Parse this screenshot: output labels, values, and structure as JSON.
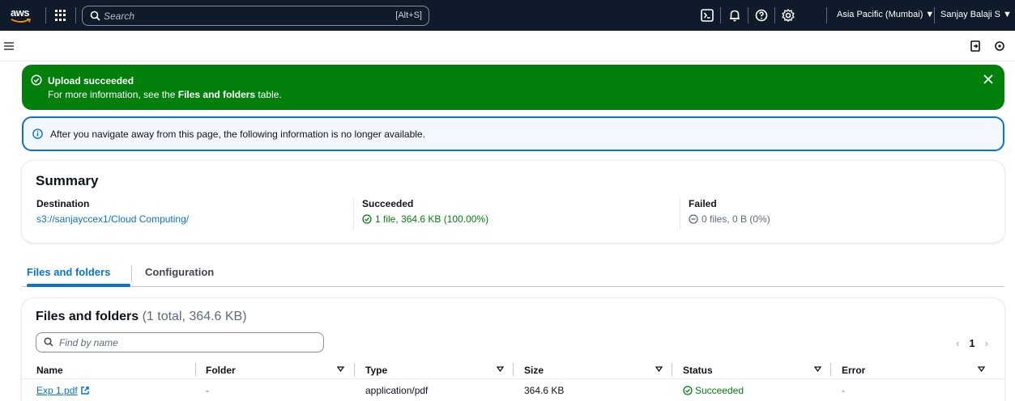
{
  "topnav": {
    "logo_text": "aws",
    "search_placeholder": "Search",
    "search_shortcut": "[Alt+S]",
    "region": "Asia Pacific (Mumbai) ▼",
    "user": "Sanjay Balaji S ▼"
  },
  "flash": {
    "title": "Upload succeeded",
    "message_prefix": "For more information, see the ",
    "message_link": "Files and folders",
    "message_suffix": " table.",
    "color": "#037f0c"
  },
  "info": {
    "text": "After you navigate away from this page, the following information is no longer available."
  },
  "summary": {
    "title": "Summary",
    "destination_label": "Destination",
    "destination_value": "s3://sanjayccex1/Cloud Computing/",
    "succeeded_label": "Succeeded",
    "succeeded_value": "1 file, 364.6 KB (100.00%)",
    "failed_label": "Failed",
    "failed_value": "0 files, 0 B (0%)"
  },
  "tabs": [
    {
      "label": "Files and folders",
      "active": true
    },
    {
      "label": "Configuration",
      "active": false
    }
  ],
  "files_table": {
    "title": "Files and folders",
    "count": "(1 total, 364.6 KB)",
    "filter_placeholder": "Find by name",
    "page": "1",
    "columns": [
      "Name",
      "Folder",
      "Type",
      "Size",
      "Status",
      "Error"
    ],
    "rows": [
      {
        "name": "Exp 1.pdf",
        "folder": "-",
        "type": "application/pdf",
        "size": "364.6 KB",
        "status": "Succeeded",
        "error": "-"
      }
    ]
  },
  "colors": {
    "nav_bg": "#0f1b2a",
    "accent": "#0972d3",
    "success": "#037f0c"
  }
}
